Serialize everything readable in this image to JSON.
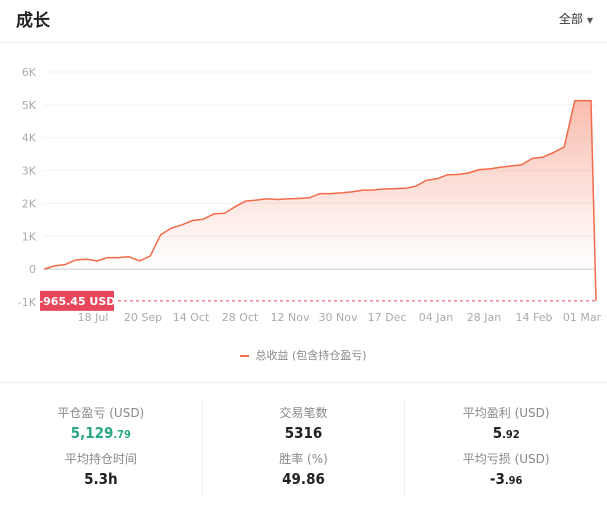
{
  "header": {
    "title": "成长",
    "range_label": "全部"
  },
  "chart_data": {
    "type": "area",
    "title": "",
    "xlabel": "",
    "ylabel": "",
    "ylim": [
      -1000,
      6000
    ],
    "y_ticks": [
      "-1K",
      "0",
      "1K",
      "2K",
      "3K",
      "4K",
      "5K",
      "6K"
    ],
    "y_tick_values": [
      -1000,
      0,
      1000,
      2000,
      3000,
      4000,
      5000,
      6000
    ],
    "x_ticks": [
      "18 Jul",
      "20 Sep",
      "14 Oct",
      "28 Oct",
      "12 Nov",
      "30 Nov",
      "17 Dec",
      "04 Jan",
      "28 Jan",
      "14 Feb",
      "01 Mar"
    ],
    "grid": true,
    "legend_position": "bottom",
    "color": "#f26b4b",
    "series": [
      {
        "name": "总收益 (包含持仓盈亏)",
        "values": [
          0,
          100,
          140,
          280,
          300,
          250,
          350,
          350,
          380,
          250,
          400,
          1050,
          1250,
          1350,
          1480,
          1520,
          1680,
          1700,
          1900,
          2070,
          2100,
          2140,
          2120,
          2140,
          2150,
          2170,
          2300,
          2300,
          2320,
          2350,
          2400,
          2410,
          2440,
          2450,
          2460,
          2520,
          2700,
          2750,
          2870,
          2880,
          2930,
          3030,
          3050,
          3100,
          3140,
          3180,
          3370,
          3410,
          3550,
          3720,
          5130,
          5130,
          -965.45
        ]
      }
    ],
    "min_marker": {
      "label": "-965.45 USD",
      "value": -965.45,
      "color": "#e8475b"
    }
  },
  "stats": [
    {
      "label": "平仓盈亏 (USD)",
      "int": "5,129",
      "dec": ".79",
      "positive": true
    },
    {
      "label": "交易笔数",
      "int": "5316",
      "dec": ""
    },
    {
      "label": "平均盈利 (USD)",
      "int": "5",
      "dec": ".92"
    },
    {
      "label": "平均持仓时间",
      "int": "5.3h",
      "dec": ""
    },
    {
      "label": "胜率 (%)",
      "int": "49.86",
      "dec": ""
    },
    {
      "label": "平均亏损 (USD)",
      "int": "-3",
      "dec": ".96"
    }
  ]
}
